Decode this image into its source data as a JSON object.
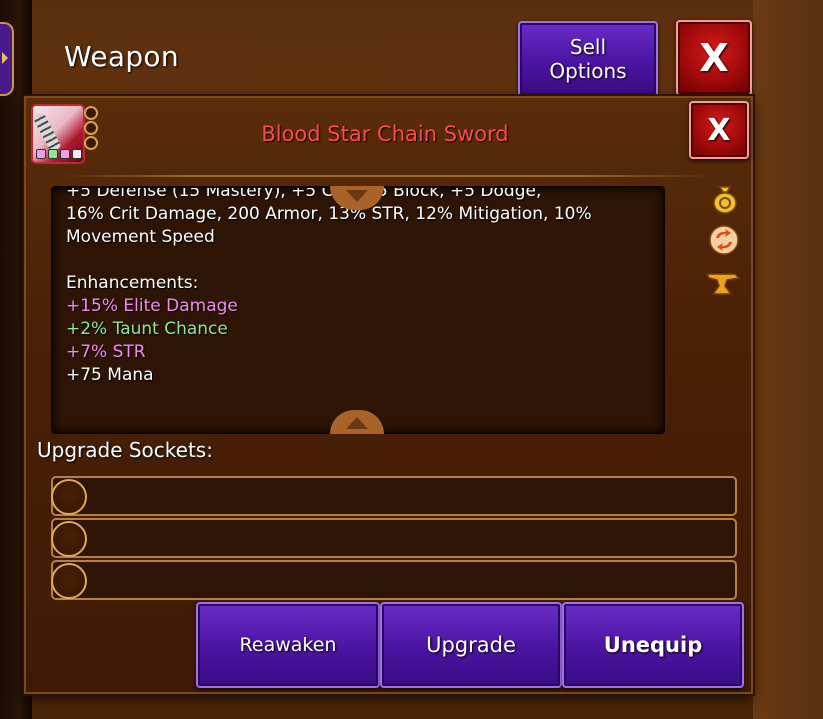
{
  "header": {
    "title": "Weapon",
    "sell_options": "Sell\nOptions",
    "close_label": "X"
  },
  "item": {
    "name": "Blood Star Chain Sword",
    "close_label": "X",
    "gem_colors": [
      "#e8a0e8",
      "#8ee88e",
      "#e8a0e8",
      "#f0f0f0"
    ],
    "name_color": "#ff4a4a"
  },
  "description": {
    "cut_line": "+5 Defense (15 Mastery), +5 Crit, +5 Block, +5 Dodge,",
    "stats_line1": "16% Crit Damage, 200 Armor, 13% STR, 12% Mitigation, 10%",
    "stats_line2": "Movement Speed",
    "enhancements_header": "Enhancements:",
    "enhancements": [
      {
        "text": "+15% Elite Damage",
        "color": "pink"
      },
      {
        "text": "+2% Taunt Chance",
        "color": "green"
      },
      {
        "text": "+7% STR",
        "color": "pink"
      },
      {
        "text": "+75 Mana",
        "color": "white"
      }
    ]
  },
  "side_icons": [
    "money-bag-icon",
    "swap-icon",
    "anvil-icon"
  ],
  "sockets": {
    "label": "Upgrade Sockets:",
    "count": 3
  },
  "actions": {
    "reawaken": "Reawaken",
    "upgrade": "Upgrade",
    "unequip": "Unequip"
  },
  "colors": {
    "button_purple": "#4a14a0",
    "close_red": "#a00a0a",
    "enhancement_pink": "#f08cf0",
    "enhancement_green": "#8ee88e"
  }
}
